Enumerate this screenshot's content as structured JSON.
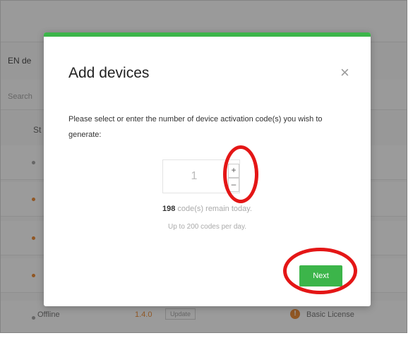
{
  "background": {
    "tab_title": "EN de",
    "search_hint": "Search",
    "column_status": "St",
    "row_status": "Offline",
    "row_version": "1.4.0",
    "update_label": "Update",
    "license_label": "Basic License"
  },
  "modal": {
    "title": "Add devices",
    "close_glyph": "×",
    "prompt": "Please select or enter the number of device activation code(s) you wish to generate:",
    "quantity": "1",
    "increment_glyph": "+",
    "decrement_glyph": "–",
    "remaining_count": "198",
    "remaining_text": " code(s) remain today.",
    "daily_limit": "Up to 200 codes per day.",
    "next_label": "Next"
  },
  "colors": {
    "accent": "#3cb54a",
    "annotation": "#e41616",
    "warning": "#e67e22"
  }
}
